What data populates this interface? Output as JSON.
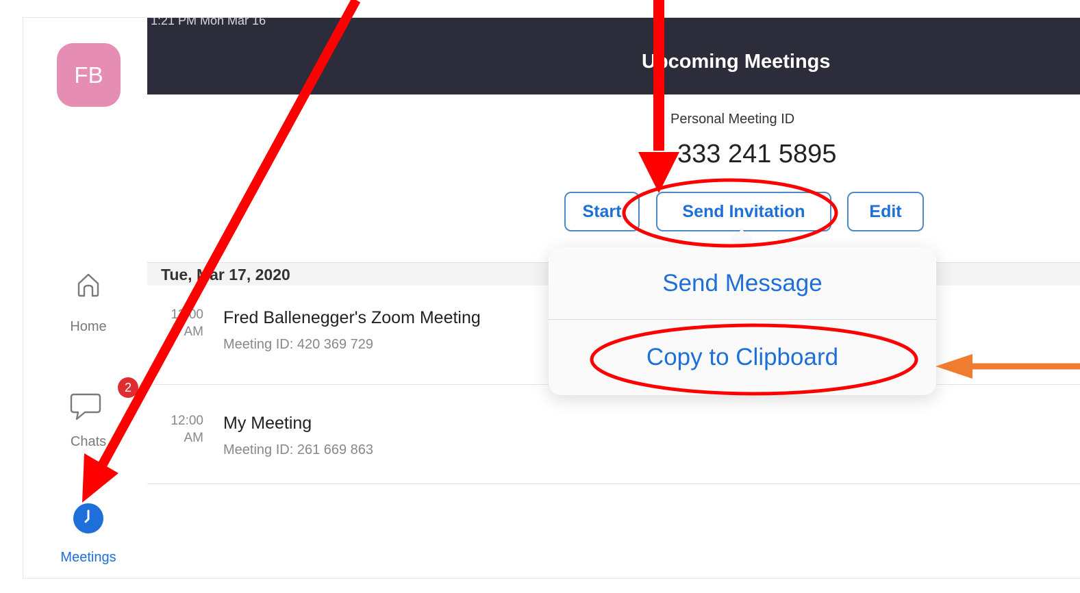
{
  "status_bar": {
    "time": "1:21 PM   Mon Mar 16"
  },
  "sidebar": {
    "avatar_initials": "FB",
    "items": [
      {
        "label": "Home",
        "icon": "home-icon"
      },
      {
        "label": "Chats",
        "icon": "chat-bubble-icon",
        "badge": "2"
      },
      {
        "label": "Meetings",
        "icon": "clock-icon",
        "active": true
      }
    ]
  },
  "header": {
    "title": "Upcoming Meetings"
  },
  "personal_meeting": {
    "label": "Personal Meeting ID",
    "number": "333 241 5895",
    "buttons": {
      "start": "Start",
      "send_invitation": "Send Invitation",
      "edit": "Edit"
    }
  },
  "schedule": {
    "date": "Tue, Mar 17, 2020",
    "meetings": [
      {
        "time": "12:00",
        "period": "AM",
        "title": "Fred Ballenegger's Zoom Meeting",
        "meeting_id": "Meeting ID: 420 369 729"
      },
      {
        "time": "12:00",
        "period": "AM",
        "title": "My Meeting",
        "meeting_id": "Meeting ID: 261 669 863"
      }
    ]
  },
  "popover": {
    "items": [
      "Send Message",
      "Copy to Clipboard"
    ]
  },
  "colors": {
    "accent": "#1e6fd9",
    "header_bg": "#2c2c3b",
    "avatar_bg": "#e58db3",
    "badge": "#e02b30",
    "annotation_red": "#ff0000",
    "annotation_orange": "#ee7d32"
  }
}
